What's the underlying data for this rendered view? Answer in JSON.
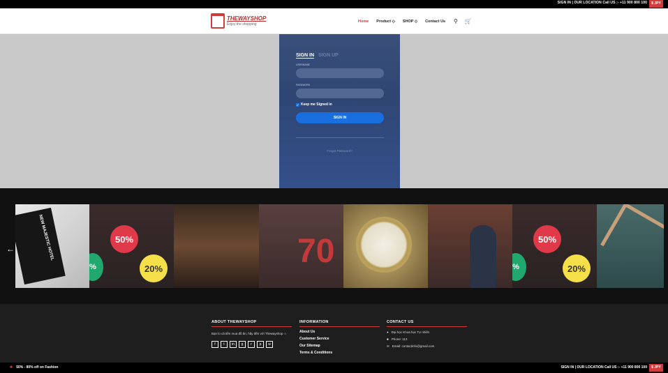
{
  "topbar": {
    "links": "SIGN IN  |  OUR LOCATION   Call US :- +11 900 800 100",
    "currency": "$ JPY"
  },
  "header": {
    "brand": "THEWAYSHOP",
    "slogan": "Enjoy the shopping",
    "menu": [
      "Home",
      "Product ◇",
      "SHOP ◇",
      "Contact Us"
    ],
    "icons": [
      "search-icon",
      "cart-icon"
    ]
  },
  "login": {
    "tab_signin": "SIGN IN",
    "tab_signup": "SIGN UP",
    "username_label": "USERNAME",
    "password_label": "PASSWORD",
    "keep_signed_in": "Keep me Signed in",
    "button": "SIGN IN",
    "forgot": "Forgot Password?"
  },
  "gallery": {
    "badges": [
      "50%",
      "20%",
      "70",
      "50%",
      "20%"
    ],
    "shirt_text": "NEW MAJESTIC HOTEL"
  },
  "footer": {
    "about_title": "ABOUT THEWAYSHOP",
    "about_text": "Bạn lo cả tiền mua đồ ăn, hãy đến với Thewayshop ☆",
    "social_icons": [
      "facebook-icon",
      "twitter-icon",
      "linkedin-icon",
      "google-icon",
      "rss-icon",
      "pinterest-icon",
      "whatsapp-icon"
    ],
    "info_title": "INFORMATION",
    "info_items": [
      "About Us",
      "Customer Service",
      "Our Sitemap",
      "Terms & Conditions"
    ],
    "contact_title": "CONTACT US",
    "contact_address": "Đại học Khoa học Tự nhiên",
    "contact_phone": "Phone: 113",
    "contact_email": "Email: contactinfo@gmail.com"
  },
  "bottombar": {
    "promo": "50% - 80% off on Fashion",
    "links": "SIGN IN  |  OUR LOCATION   Call US :- +11 900 800 100",
    "currency": "$ JPY"
  }
}
